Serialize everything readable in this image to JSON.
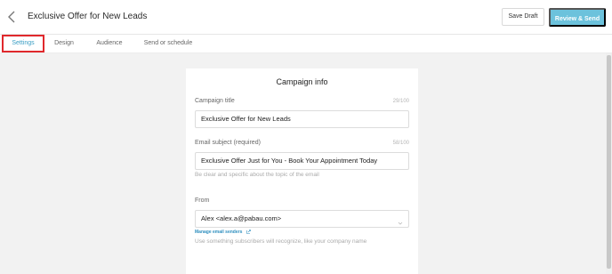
{
  "header": {
    "back_icon": "chevron-left-icon",
    "title": "Exclusive Offer for New Leads",
    "save_draft_label": "Save Draft",
    "review_send_label": "Review & Send",
    "review_send_color": "#6cc2dc"
  },
  "tabs": [
    {
      "label": "Settings",
      "active": true
    },
    {
      "label": "Design",
      "active": false
    },
    {
      "label": "Audience",
      "active": false
    },
    {
      "label": "Send or schedule",
      "active": false
    }
  ],
  "highlight_color": "#e0282c",
  "campaign_info": {
    "heading": "Campaign info",
    "campaign_title": {
      "label": "Campaign title",
      "counter": "29/100",
      "value": "Exclusive Offer for New Leads"
    },
    "email_subject": {
      "label": "Email subject (required)",
      "counter": "58/100",
      "value": "Exclusive Offer Just for You - Book Your Appointment Today",
      "hint": "Be clear and specific about the topic of the email"
    },
    "from": {
      "label": "From",
      "value": "Alex <alex.a@pabau.com>",
      "dropdown_icon": "chevron-down-icon",
      "manage_link": "Manage email senders",
      "manage_link_icon": "external-link-icon",
      "hint": "Use something subscribers will recognize, like your company name"
    }
  }
}
